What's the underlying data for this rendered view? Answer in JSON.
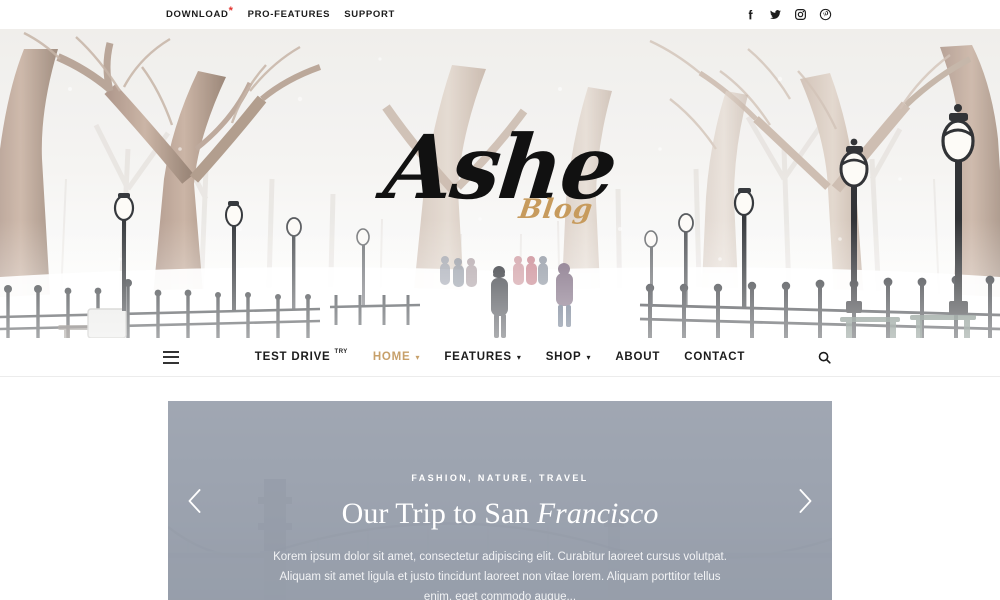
{
  "topbar": {
    "links": [
      {
        "label": "DOWNLOAD",
        "badge": "*"
      },
      {
        "label": "PRO-FEATURES",
        "badge": ""
      },
      {
        "label": "SUPPORT",
        "badge": ""
      }
    ],
    "social": [
      {
        "name": "facebook-icon",
        "title": "Facebook"
      },
      {
        "name": "twitter-icon",
        "title": "Twitter"
      },
      {
        "name": "instagram-icon",
        "title": "Instagram"
      },
      {
        "name": "pinterest-icon",
        "title": "Pinterest"
      }
    ],
    "badge_color": "#e3342f"
  },
  "hero": {
    "logo_main": "Ashe",
    "logo_sub": "Blog",
    "logo_sub_color": "#c79b5d",
    "image_description": "Snow covered park path lined with bare trees, black lampposts, iron fence and people walking"
  },
  "nav": {
    "menu_icon": "hamburger-icon",
    "search_icon": "search-icon",
    "items": [
      {
        "label": "TEST DRIVE",
        "sup": "TRY",
        "chevron": false,
        "active": false
      },
      {
        "label": "HOME",
        "sup": "",
        "chevron": true,
        "active": true
      },
      {
        "label": "FEATURES",
        "sup": "",
        "chevron": true,
        "active": false
      },
      {
        "label": "SHOP",
        "sup": "",
        "chevron": true,
        "active": false
      },
      {
        "label": "ABOUT",
        "sup": "",
        "chevron": false,
        "active": false
      },
      {
        "label": "CONTACT",
        "sup": "",
        "chevron": false,
        "active": false
      }
    ],
    "active_color": "#c7a06a"
  },
  "slider": {
    "prev_icon": "chevron-left-icon",
    "next_icon": "chevron-right-icon",
    "slide": {
      "categories": "FASHION, NATURE, TRAVEL",
      "title_plain": "Our Trip to San ",
      "title_italic": "Francisco",
      "excerpt": "Korem ipsum dolor sit amet, consectetur adipiscing elit. Curabitur laoreet cursus volutpat. Aliquam sit amet ligula et justo tincidunt laoreet non vitae lorem. Aliquam porttitor tellus enim, eget commodo augue...",
      "image_description": "Golden Gate Bridge in fog behind a grey-blue overlay",
      "overlay_color": "#969daa"
    }
  }
}
